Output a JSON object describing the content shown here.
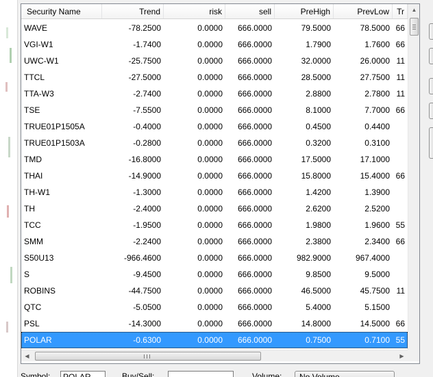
{
  "grid": {
    "columns": [
      "Security Name",
      "Trend",
      "risk",
      "sell",
      "PreHigh",
      "PrevLow",
      "Tr"
    ],
    "rows": [
      [
        "WAVE",
        "-78.2500",
        "0.0000",
        "666.0000",
        "79.5000",
        "78.5000",
        "66"
      ],
      [
        "VGI-W1",
        "-1.7400",
        "0.0000",
        "666.0000",
        "1.7900",
        "1.7600",
        "66"
      ],
      [
        "UWC-W1",
        "-25.7500",
        "0.0000",
        "666.0000",
        "32.0000",
        "26.0000",
        "11"
      ],
      [
        "TTCL",
        "-27.5000",
        "0.0000",
        "666.0000",
        "28.5000",
        "27.7500",
        "11"
      ],
      [
        "TTA-W3",
        "-2.7400",
        "0.0000",
        "666.0000",
        "2.8800",
        "2.7800",
        "11"
      ],
      [
        "TSE",
        "-7.5500",
        "0.0000",
        "666.0000",
        "8.1000",
        "7.7000",
        "66"
      ],
      [
        "TRUE01P1505A",
        "-0.4000",
        "0.0000",
        "666.0000",
        "0.4500",
        "0.4400",
        ""
      ],
      [
        "TRUE01P1503A",
        "-0.2800",
        "0.0000",
        "666.0000",
        "0.3200",
        "0.3100",
        ""
      ],
      [
        "TMD",
        "-16.8000",
        "0.0000",
        "666.0000",
        "17.5000",
        "17.1000",
        ""
      ],
      [
        "THAI",
        "-14.9000",
        "0.0000",
        "666.0000",
        "15.8000",
        "15.4000",
        "66"
      ],
      [
        "TH-W1",
        "-1.3000",
        "0.0000",
        "666.0000",
        "1.4200",
        "1.3900",
        ""
      ],
      [
        "TH",
        "-2.4000",
        "0.0000",
        "666.0000",
        "2.6200",
        "2.5200",
        ""
      ],
      [
        "TCC",
        "-1.9500",
        "0.0000",
        "666.0000",
        "1.9800",
        "1.9600",
        "55"
      ],
      [
        "SMM",
        "-2.2400",
        "0.0000",
        "666.0000",
        "2.3800",
        "2.3400",
        "66"
      ],
      [
        "S50U13",
        "-966.4600",
        "0.0000",
        "666.0000",
        "982.9000",
        "967.4000",
        ""
      ],
      [
        "S",
        "-9.4500",
        "0.0000",
        "666.0000",
        "9.8500",
        "9.5000",
        ""
      ],
      [
        "ROBINS",
        "-44.7500",
        "0.0000",
        "666.0000",
        "46.5000",
        "45.7500",
        "11"
      ],
      [
        "QTC",
        "-5.0500",
        "0.0000",
        "666.0000",
        "5.4000",
        "5.1500",
        ""
      ],
      [
        "PSL",
        "-14.3000",
        "0.0000",
        "666.0000",
        "14.8000",
        "14.5000",
        "66"
      ],
      [
        "POLAR",
        "-0.6300",
        "0.0000",
        "666.0000",
        "0.7500",
        "0.7100",
        "55"
      ]
    ],
    "selected_row": 19,
    "colors": {
      "selection": "#3399ff",
      "border": "#828790",
      "header_bg": "#ffffff"
    }
  },
  "scrollbars": {
    "up_icon": "triangle-up",
    "left_icon": "triangle-left",
    "right_icon": "triangle-right",
    "thumb_grip": "|||"
  },
  "bottom": {
    "symbol_label": "Symbol:",
    "symbol_value": "POLAR",
    "buysell_label": "Buy/Sell:",
    "volume_label": "Volume:",
    "no_volume_button": "No Volume"
  }
}
